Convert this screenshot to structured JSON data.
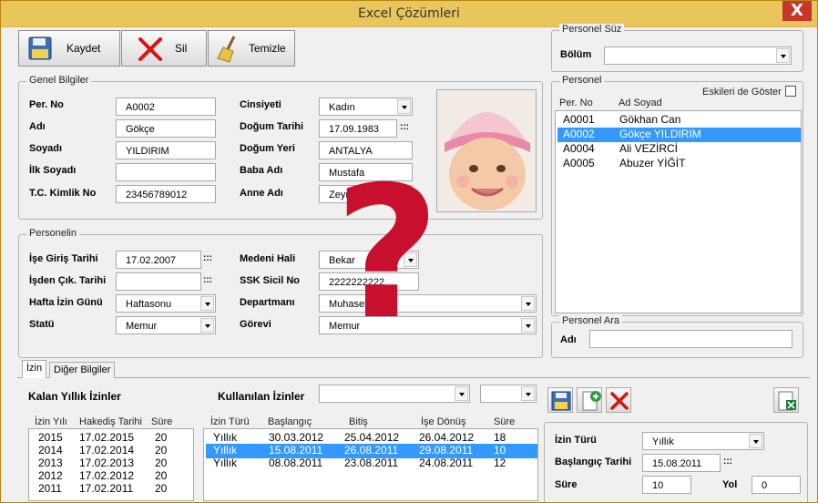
{
  "window": {
    "title": "Excel Çözümleri",
    "close": "X"
  },
  "toolbar": {
    "save": "Kaydet",
    "delete": "Sil",
    "clear": "Temizle"
  },
  "genel": {
    "title": "Genel Bilgiler",
    "per_no_label": "Per. No",
    "per_no": "A0002",
    "adi_label": "Adı",
    "adi": "Gökçe",
    "soyadi_label": "Soyadı",
    "soyadi": "YILDIRIM",
    "ilk_soyadi_label": "İlk Soyadı",
    "ilk_soyadi": "",
    "tc_label": "T.C. Kimlik No",
    "tc": "23456789012",
    "cinsiyet_label": "Cinsiyeti",
    "cinsiyet": "Kadın",
    "dogum_tarihi_label": "Doğum Tarihi",
    "dogum_tarihi": "17.09.1983",
    "dogum_yeri_label": "Doğum Yeri",
    "dogum_yeri": "ANTALYA",
    "baba_label": "Baba Adı",
    "baba": "Mustafa",
    "anne_label": "Anne Adı",
    "anne": "Zeynep",
    "dots": ":::"
  },
  "personelin": {
    "title": "Personelin",
    "giris_label": "İşe Giriş Tarihi",
    "giris": "17.02.2007",
    "cikis_label": "İşden Çık. Tarihi",
    "cikis": "",
    "izin_gunu_label": "Hafta İzin Günü",
    "izin_gunu": "Haftasonu",
    "statu_label": "Statü",
    "statu": "Memur",
    "medeni_label": "Medeni Hali",
    "medeni": "Bekar",
    "ssk_label": "SSK Sicil  No",
    "ssk": "2222222222",
    "departman_label": "Departmanı",
    "departman": "Muhasebe",
    "gorev_label": "Görevi",
    "gorev": "Memur"
  },
  "suz": {
    "title": "Personel Süz",
    "bolum_label": "Bölüm",
    "bolum": ""
  },
  "personel": {
    "title": "Personel",
    "eskiler": "Eskileri de Göster",
    "col_no": "Per. No",
    "col_ad": "Ad Soyad",
    "rows": [
      {
        "no": "A0001",
        "ad": "Gökhan Can"
      },
      {
        "no": "A0002",
        "ad": "Gökçe YILDIRIM"
      },
      {
        "no": "A0004",
        "ad": "Ali VEZİRCİ"
      },
      {
        "no": "A0005",
        "ad": "Abuzer YİĞİT"
      }
    ]
  },
  "ara": {
    "title": "Personel Ara",
    "adi_label": "Adı",
    "adi": ""
  },
  "tabs": {
    "izin": "İzin",
    "diger": "Diğer Bilgiler"
  },
  "kalan": {
    "title": "Kalan Yıllık İzinler",
    "cols": [
      "İzin Yılı",
      "Hakediş Tarihi",
      "Süre"
    ],
    "rows": [
      [
        "2015",
        "17.02.2015",
        "20"
      ],
      [
        "2014",
        "17.02.2014",
        "20"
      ],
      [
        "2013",
        "17.02.2013",
        "20"
      ],
      [
        "2012",
        "17.02.2012",
        "20"
      ],
      [
        "2011",
        "17.02.2011",
        "20"
      ]
    ]
  },
  "kullanilan": {
    "title": "Kullanılan İzinler",
    "cols": [
      "İzin Türü",
      "Başlangıç",
      "Bitiş",
      "İşe Dönüş",
      "Süre"
    ],
    "rows": [
      [
        "Yıllık",
        "30.03.2012",
        "25.04.2012",
        "26.04.2012",
        "18"
      ],
      [
        "Yıllık",
        "15.08.2011",
        "26.08.2011",
        "29.08.2011",
        "10"
      ],
      [
        "Yıllık",
        "08.08.2011",
        "23.08.2011",
        "24.08.2011",
        "12"
      ]
    ]
  },
  "izinform": {
    "tur_label": "İzin Türü",
    "tur": "Yıllık",
    "bas_label": "Başlangıç Tarihi",
    "bas": "15.08.2011",
    "sure_label": "Süre",
    "sure": "10",
    "yol_label": "Yol",
    "yol": "0"
  },
  "overlay": {
    "question": "?"
  },
  "colors": {
    "title_bar": "#e9c65c",
    "selection": "#3399ff",
    "question": "#c8102e"
  }
}
